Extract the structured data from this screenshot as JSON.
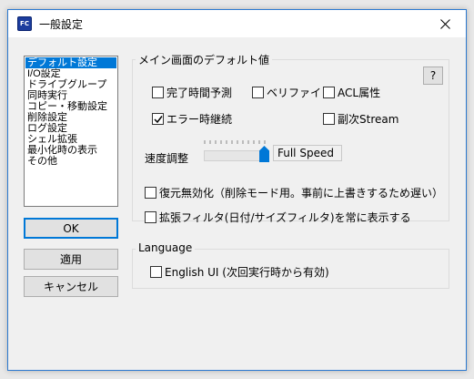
{
  "window": {
    "title": "一般設定",
    "app_icon_text": "FC"
  },
  "sidebar": {
    "items": [
      "デフォルト設定",
      "I/O設定",
      "ドライブグループ",
      "同時実行",
      "コピー・移動設定",
      "削除設定",
      "ログ設定",
      "シェル拡張",
      "最小化時の表示",
      "その他"
    ],
    "selected_index": 0
  },
  "buttons": {
    "ok": "OK",
    "apply": "適用",
    "cancel": "キャンセル"
  },
  "main_defaults": {
    "group_label": "メイン画面のデフォルト値",
    "help": "?",
    "checkboxes": [
      {
        "label": "完了時間予測",
        "checked": false
      },
      {
        "label": "ベリファイ",
        "checked": false
      },
      {
        "label": "ACL属性",
        "checked": false
      },
      {
        "label": "エラー時継続",
        "checked": true
      },
      {
        "label": "副次Stream",
        "checked": false
      }
    ],
    "speed_label": "速度調整",
    "speed_value": "Full Speed",
    "speed_level": 1.0,
    "disable_restore": {
      "label": "復元無効化（削除モード用。事前に上書きするため遅い）",
      "checked": false
    },
    "ext_filter": {
      "label": "拡張フィルタ(日付/サイズフィルタ)を常に表示する",
      "checked": false
    }
  },
  "language": {
    "group_label": "Language",
    "english_ui": {
      "label": "English UI (次回実行時から有効)",
      "checked": false
    }
  }
}
